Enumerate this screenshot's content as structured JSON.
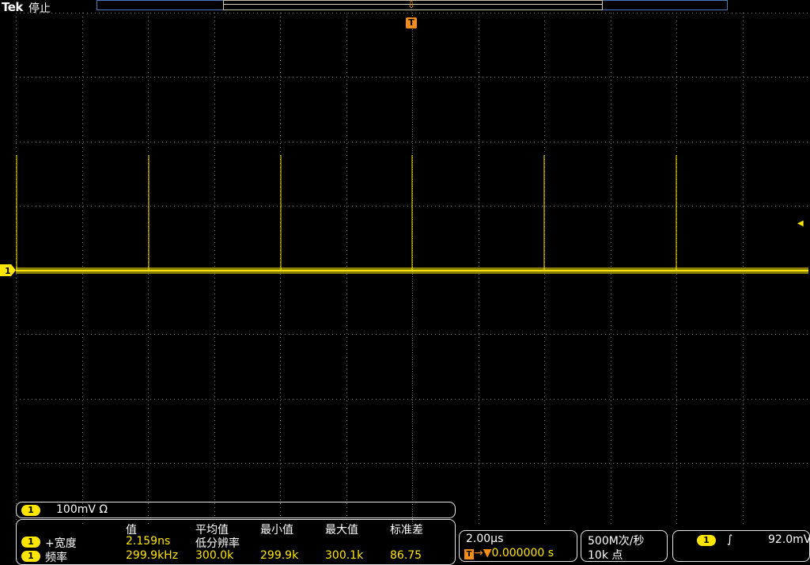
{
  "header": {
    "brand": "Tek",
    "state": "停止"
  },
  "trigger_marker": {
    "label": "T"
  },
  "channel": {
    "number": "1",
    "scale": "100mV Ω"
  },
  "measurements": {
    "headers": {
      "value": "值",
      "mean": "平均值",
      "min": "最小值",
      "max": "最大值",
      "stddev": "标准差"
    },
    "rows": [
      {
        "channel": "1",
        "label": "+宽度",
        "value": "2.159ns",
        "mean": "低分辨率",
        "min": "",
        "max": "",
        "stddev": ""
      },
      {
        "channel": "1",
        "label": "频率",
        "value": "299.9kHz",
        "mean": "300.0k",
        "min": "299.9k",
        "max": "300.1k",
        "stddev": "86.75"
      }
    ]
  },
  "timebase": {
    "scale": "2.00µs",
    "position": "0.000000 s",
    "position_icon": "T→▼"
  },
  "acquisition": {
    "rate": "500M次/秒",
    "points": "10k 点"
  },
  "trigger": {
    "channel": "1",
    "slope_icon": "rising-edge-icon",
    "slope_glyph": "∫",
    "level": "92.0mV"
  },
  "colors": {
    "ch1": "#ffe600",
    "trigger": "#f28c1b",
    "grid": "#777777",
    "record_bar": "#4a7bb5"
  }
}
